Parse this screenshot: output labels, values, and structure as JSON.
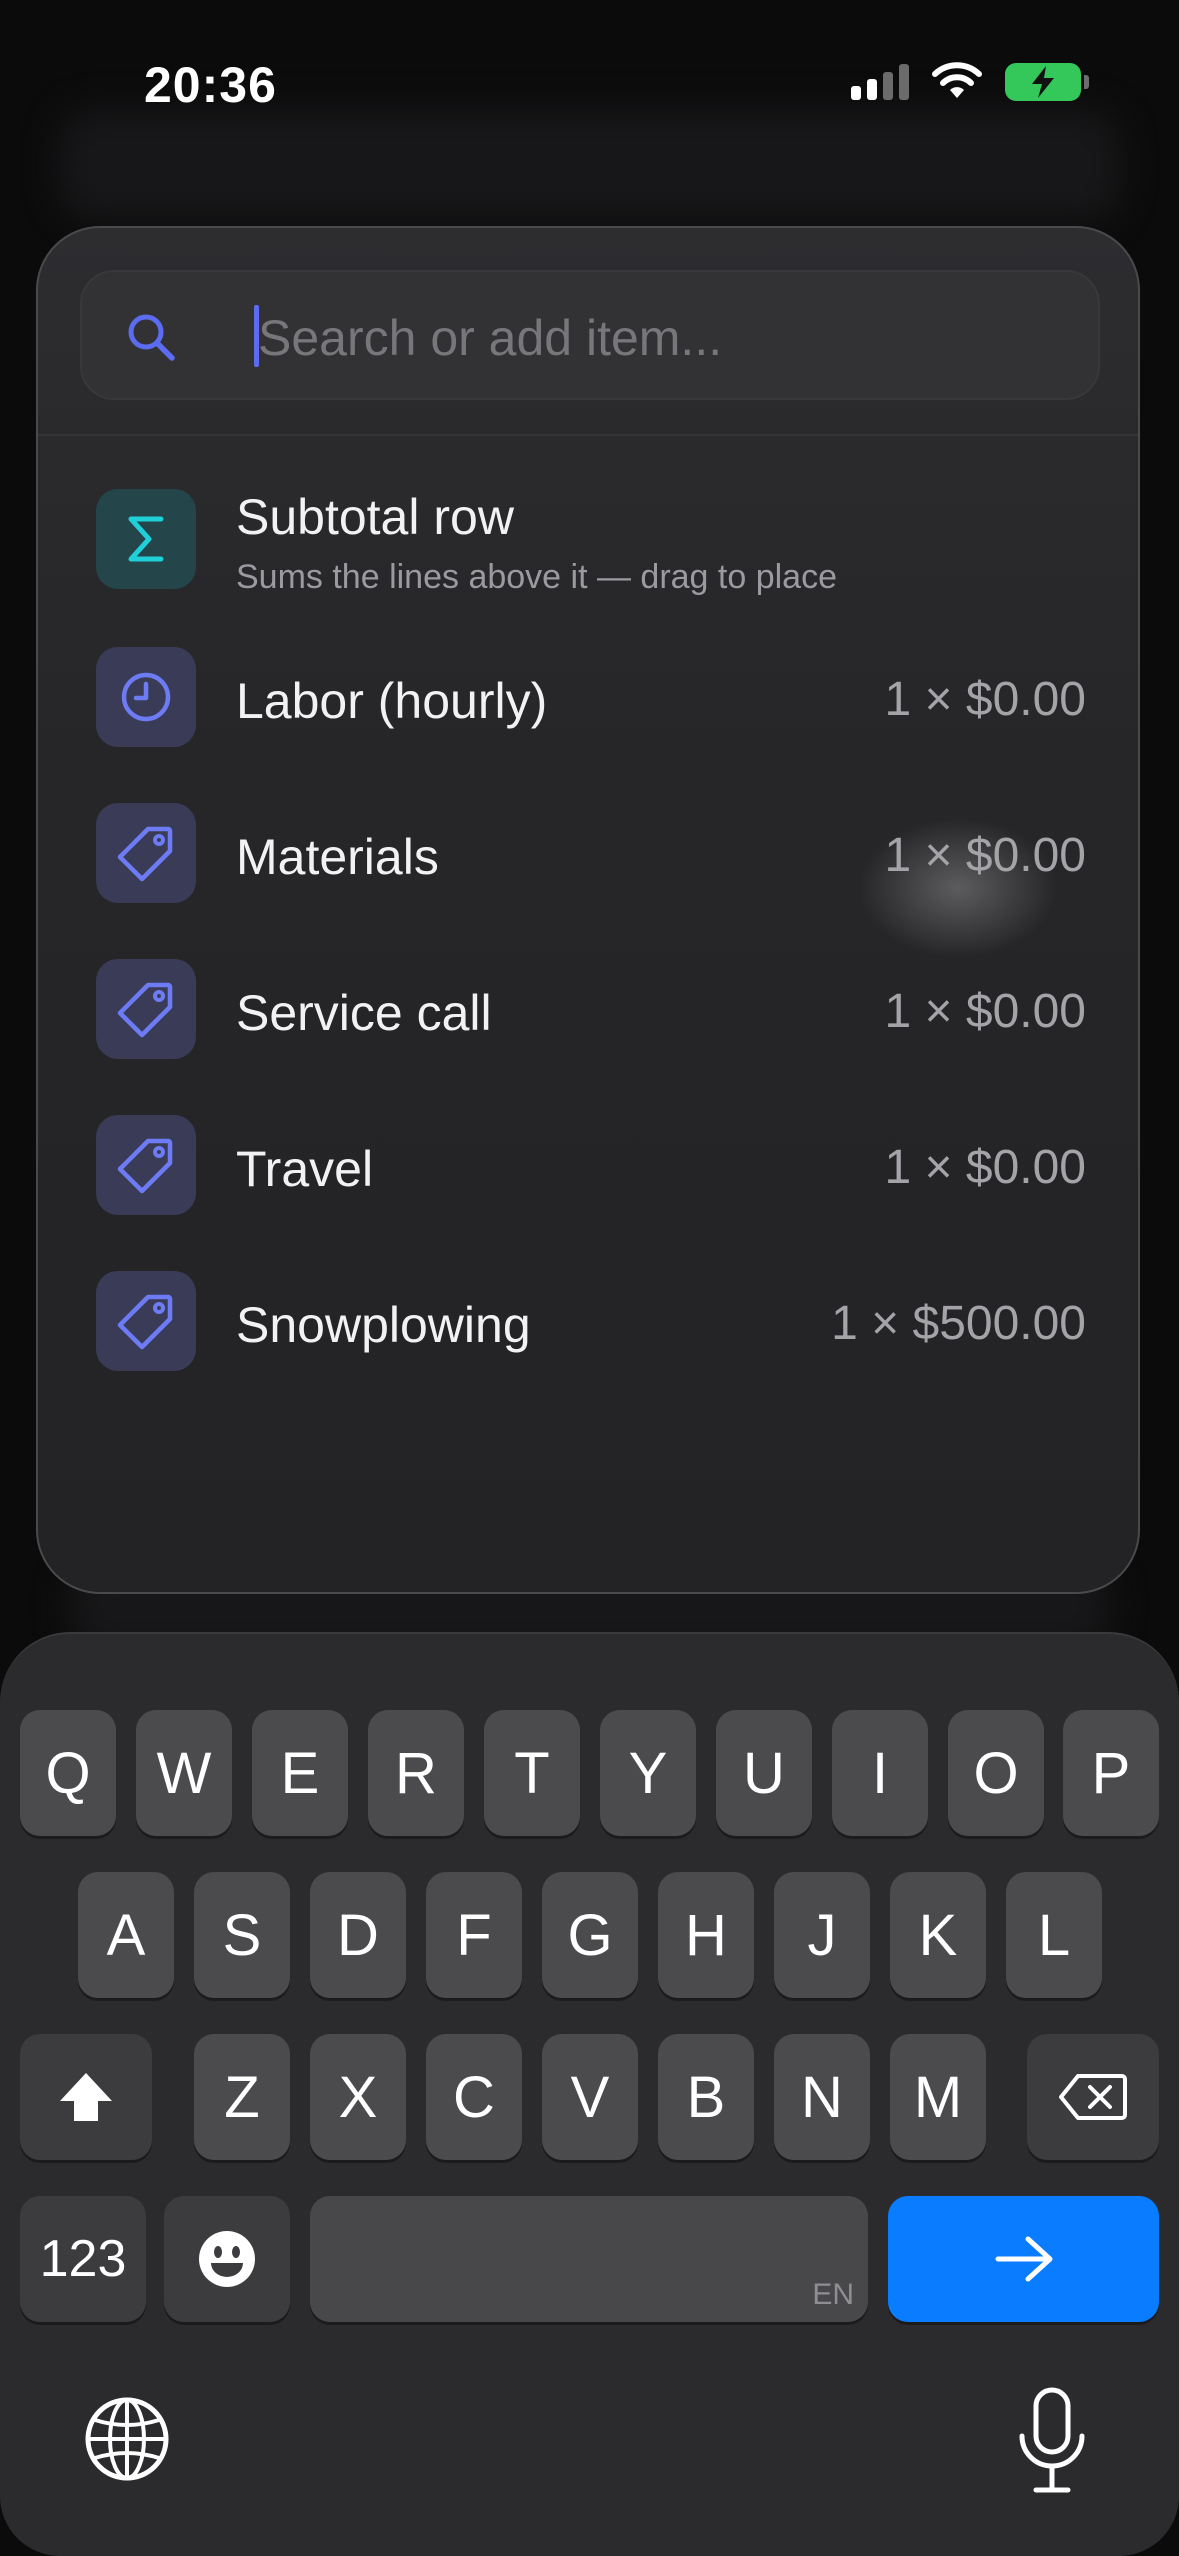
{
  "status_bar": {
    "time": "20:36",
    "battery_color": "#34c759"
  },
  "search": {
    "placeholder": "Search or add item...",
    "value": ""
  },
  "items": [
    {
      "icon": "sigma-icon",
      "title": "Subtotal row",
      "subtitle": "Sums the lines above it — drag to place",
      "price": ""
    },
    {
      "icon": "clock-icon",
      "title": "Labor (hourly)",
      "price": "1 × $0.00"
    },
    {
      "icon": "tag-icon",
      "title": "Materials",
      "price": "1 × $0.00"
    },
    {
      "icon": "tag-icon",
      "title": "Service call",
      "price": "1 × $0.00"
    },
    {
      "icon": "tag-icon",
      "title": "Travel",
      "price": "1 × $0.00"
    },
    {
      "icon": "tag-icon",
      "title": "Snowplowing",
      "price": "1 × $500.00"
    }
  ],
  "keyboard": {
    "row1": [
      "Q",
      "W",
      "E",
      "R",
      "T",
      "Y",
      "U",
      "I",
      "O",
      "P"
    ],
    "row2": [
      "A",
      "S",
      "D",
      "F",
      "G",
      "H",
      "J",
      "K",
      "L"
    ],
    "row3": [
      "Z",
      "X",
      "C",
      "V",
      "B",
      "N",
      "M"
    ],
    "numbers_label": "123",
    "space_language": "EN",
    "accent_color": "#0a7cff"
  }
}
